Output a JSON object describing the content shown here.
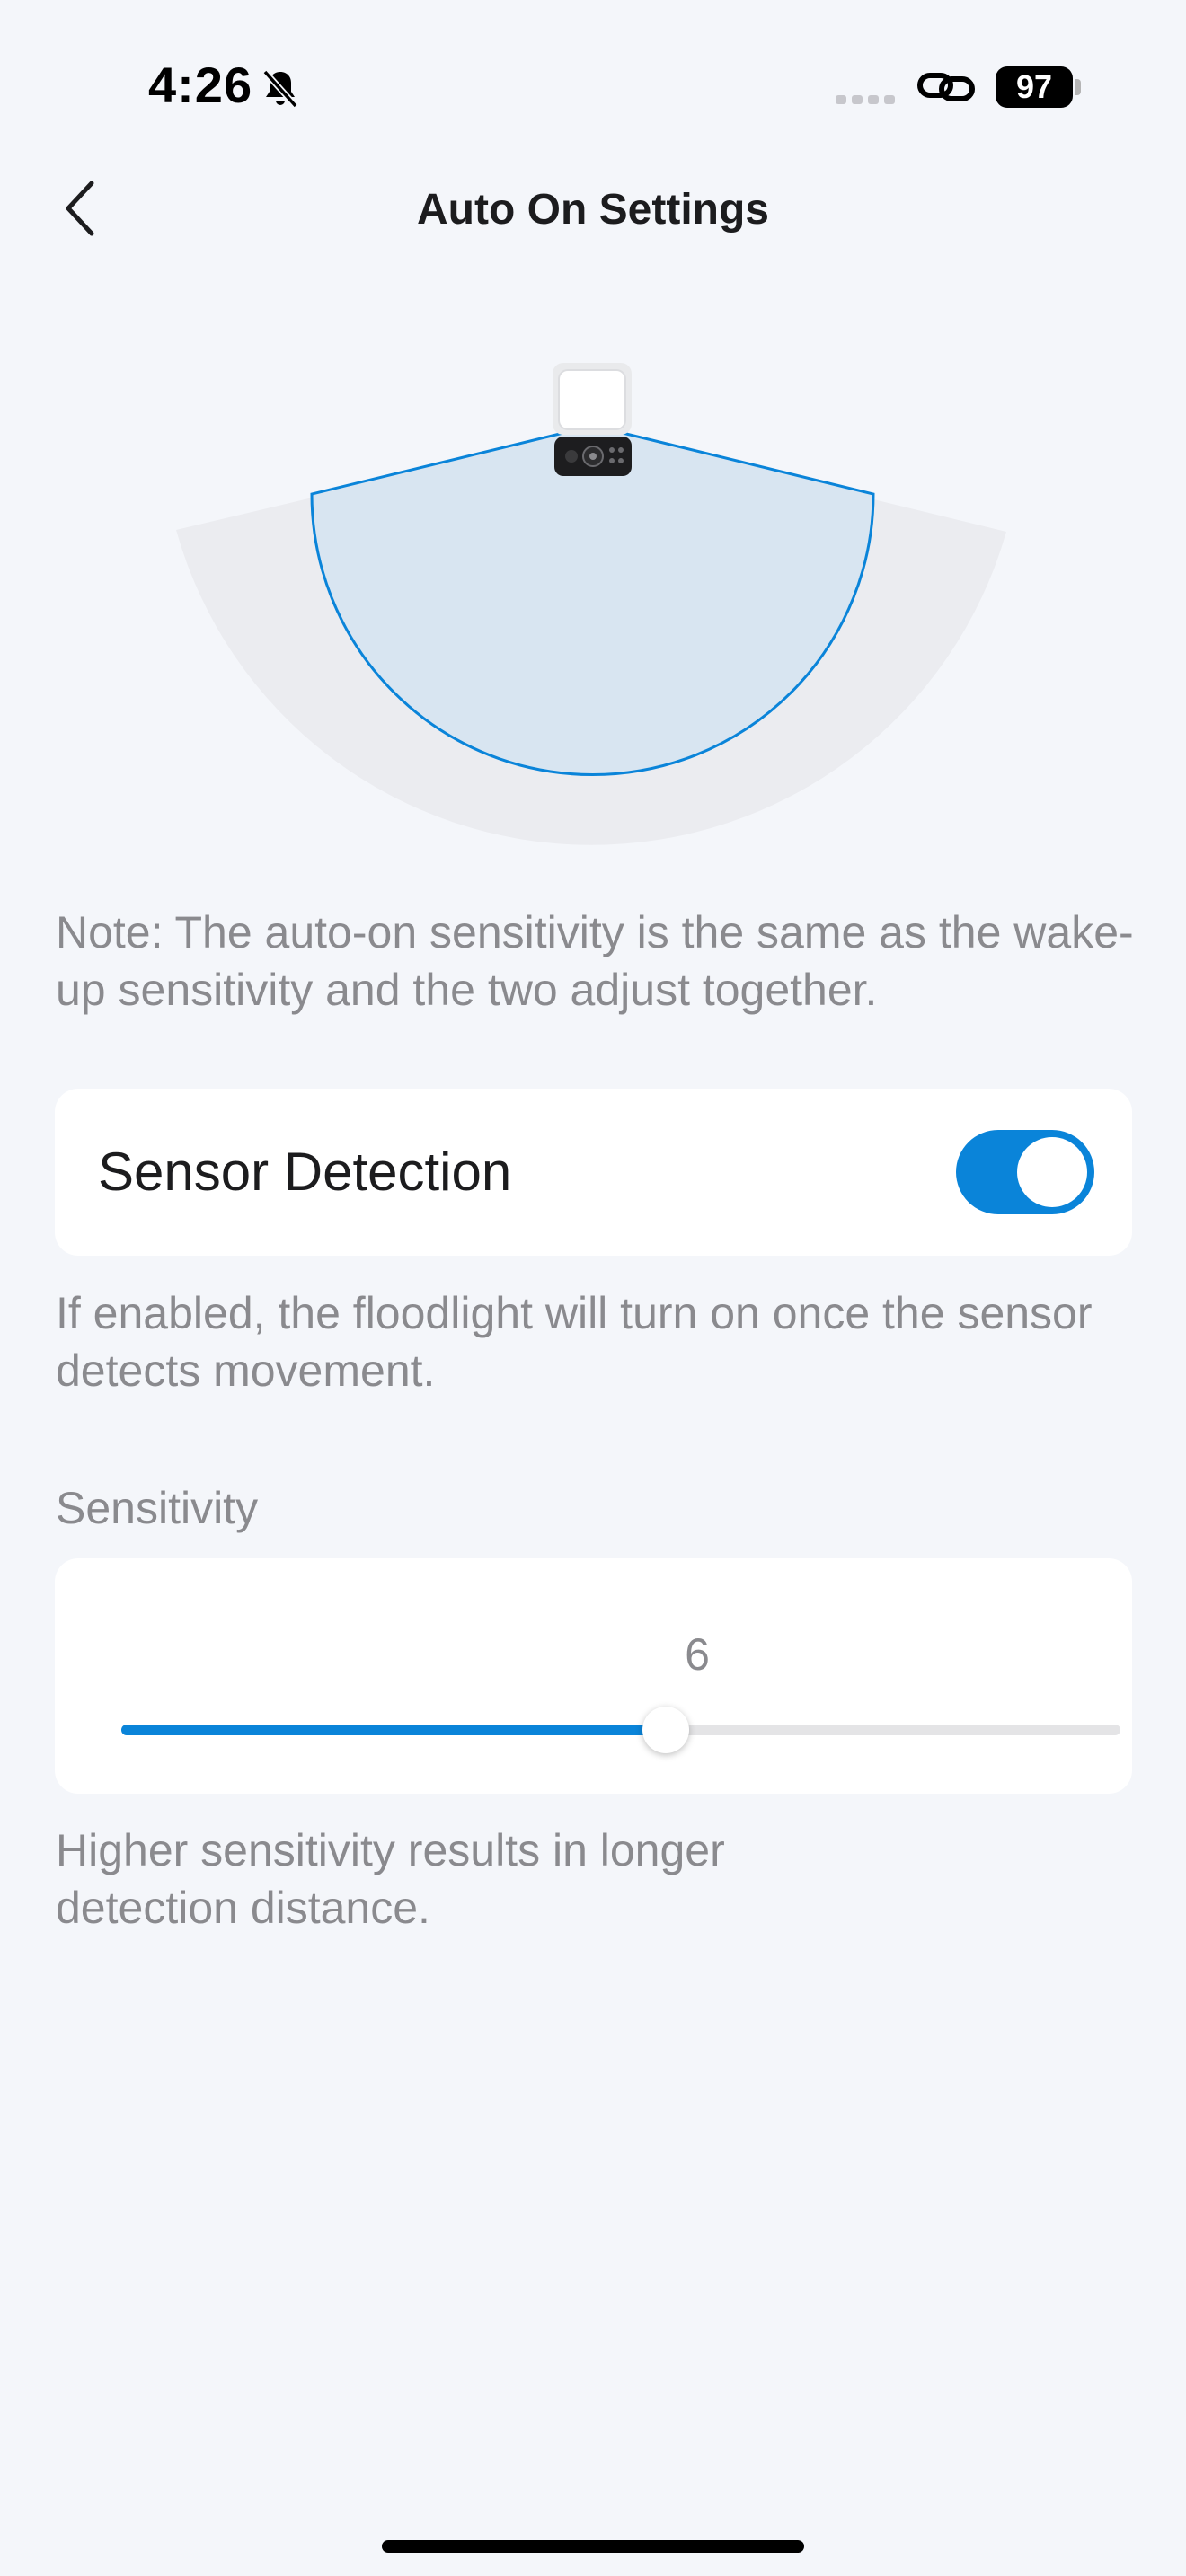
{
  "status_bar": {
    "time": "4:26",
    "battery": "97",
    "icons": [
      "bell-off-icon",
      "signal-icon",
      "link-icon",
      "battery-icon"
    ]
  },
  "nav": {
    "title": "Auto On Settings",
    "back_icon": "chevron-left-icon"
  },
  "illustration": {
    "device": "camera-floodlight-icon",
    "accent_color": "#0a84d9",
    "inner_fill": "#d8e5f1",
    "outer_fill": "#ebecf0"
  },
  "note": "Note: The auto-on sensitivity is the same as the wake-up sensitivity and the two adjust together.",
  "sensor_detection": {
    "label": "Sensor Detection",
    "enabled": true,
    "description": "If enabled, the floodlight will turn on once the sensor detects movement."
  },
  "sensitivity": {
    "section_label": "Sensitivity",
    "value": "6",
    "fill_fraction": 0.545,
    "description": "Higher sensitivity results in longer detection distance."
  },
  "colors": {
    "background": "#f4f6fa",
    "accent": "#0a84d9",
    "secondary_text": "#8a8a8e"
  }
}
